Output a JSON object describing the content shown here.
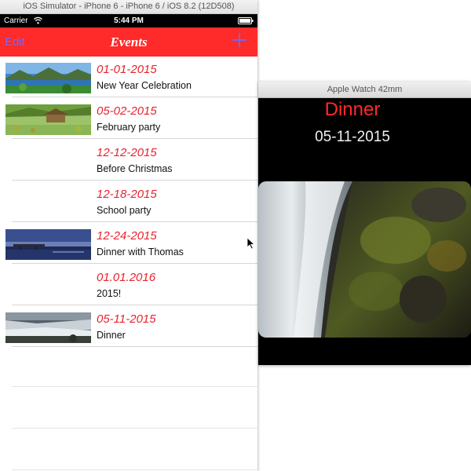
{
  "simulator": {
    "window_title": "iOS Simulator - iPhone 6 - iPhone 6 / iOS 8.2 (12D508)",
    "status_bar": {
      "carrier": "Carrier",
      "time": "5:44 PM",
      "wifi_icon": "wifi-icon",
      "battery_icon": "battery-icon"
    },
    "nav_bar": {
      "left_label": "Edit",
      "title": "Events",
      "right_icon": "plus-icon",
      "background_color": "#ff2a2a",
      "button_color": "#6b6bff"
    },
    "events": [
      {
        "date": "01-01-2015",
        "name": "New Year Celebration",
        "has_thumbnail": true,
        "thumbnail": "lake-mountain-image"
      },
      {
        "date": "05-02-2015",
        "name": "February party",
        "has_thumbnail": true,
        "thumbnail": "meadow-cabin-image"
      },
      {
        "date": "12-12-2015",
        "name": "Before Christmas",
        "has_thumbnail": false
      },
      {
        "date": "12-18-2015",
        "name": "School party",
        "has_thumbnail": false
      },
      {
        "date": "12-24-2015",
        "name": "Dinner with Thomas",
        "has_thumbnail": true,
        "thumbnail": "night-bridge-image"
      },
      {
        "date": "01.01.2016",
        "name": "2015!",
        "has_thumbnail": false
      },
      {
        "date": "05-11-2015",
        "name": "Dinner",
        "has_thumbnail": true,
        "thumbnail": "river-rapids-image"
      }
    ],
    "date_color": "#e8232c"
  },
  "watch": {
    "window_title": "Apple Watch 42mm",
    "event_name": "Dinner",
    "event_date": "05-11-2015",
    "image": "waterfall-image",
    "accent_color": "#ff2a2a"
  }
}
